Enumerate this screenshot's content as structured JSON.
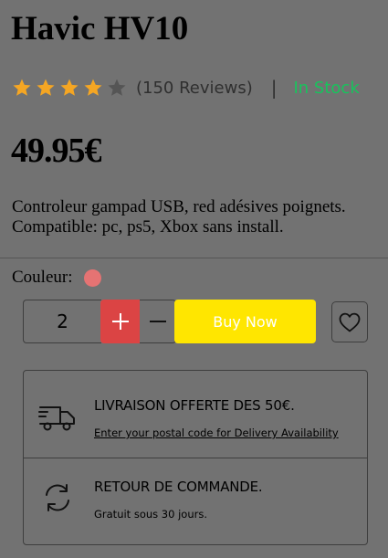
{
  "product": {
    "title": "Havic HV10",
    "rating": 4,
    "rating_max": 5,
    "reviews": "(150 Reviews)",
    "separator": "|",
    "stock": "In Stock",
    "price": "49.95€",
    "description": "Controleur gampad USB, red adésives poignets. Compatible: pc, ps5, Xbox sans install."
  },
  "color": {
    "label": "Couleur:",
    "swatch": "#e57373"
  },
  "purchase": {
    "quantity": "2",
    "buy_label": "Buy Now"
  },
  "delivery": {
    "free_title": "LIVRAISON OFFERTE DES 50€.",
    "free_link": "Enter your postal code for Delivery Availability",
    "return_title": "RETOUR DE COMMANDE.",
    "return_sub": "Gratuit sous 30 jours."
  },
  "colors": {
    "star_filled": "#f5a623",
    "star_empty": "#555555",
    "stock": "#17c45c",
    "accent_red": "#db4444",
    "buy_yellow": "#ffe600"
  }
}
